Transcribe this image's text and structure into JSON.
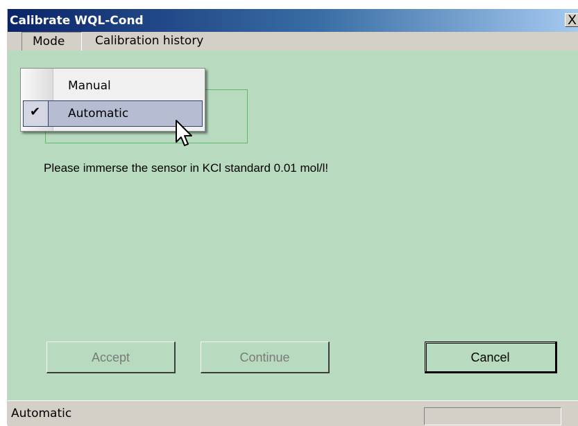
{
  "window": {
    "title": "Calibrate WQL-Cond",
    "close_glyph": "X"
  },
  "menubar": {
    "items": [
      {
        "label": "Mode"
      },
      {
        "label": "Calibration history"
      }
    ]
  },
  "dropdown": {
    "items": [
      {
        "label": "Manual",
        "checked": false
      },
      {
        "label": "Automatic",
        "checked": true,
        "highlighted": true
      }
    ],
    "check_glyph": "✔"
  },
  "main": {
    "message": "Please immerse the sensor in KCl standard 0.01 mol/l!"
  },
  "buttons": {
    "accept_label": "Accept",
    "continue_label": "Continue",
    "cancel_label": "Cancel"
  },
  "statusbar": {
    "text": "Automatic",
    "panel_text": ""
  },
  "colors": {
    "background": "#b8dbbf",
    "titlebar_start": "#0a246a",
    "titlebar_end": "#a6caf0",
    "menu_highlight": "#b6bdd2"
  }
}
